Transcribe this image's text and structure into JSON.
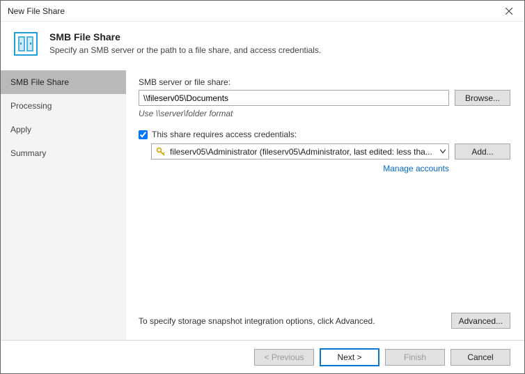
{
  "window": {
    "title": "New File Share"
  },
  "header": {
    "title": "SMB File Share",
    "subtitle": "Specify an SMB server or the path to a file share, and access credentials."
  },
  "sidebar": {
    "items": [
      {
        "label": "SMB File Share",
        "selected": true
      },
      {
        "label": "Processing",
        "selected": false
      },
      {
        "label": "Apply",
        "selected": false
      },
      {
        "label": "Summary",
        "selected": false
      }
    ]
  },
  "content": {
    "server_label": "SMB server or file share:",
    "server_value": "\\\\fileserv05\\Documents",
    "browse_label": "Browse...",
    "format_hint": "Use \\\\server\\folder format",
    "creds_checkbox_label": "This share requires access credentials:",
    "creds_checked": true,
    "creds_selected": "fileserv05\\Administrator (fileserv05\\Administrator, last edited: less tha...",
    "add_label": "Add...",
    "manage_link": "Manage accounts",
    "snapshot_text": "To specify storage snapshot integration options, click Advanced.",
    "advanced_label": "Advanced..."
  },
  "footer": {
    "previous": "< Previous",
    "next": "Next >",
    "finish": "Finish",
    "cancel": "Cancel"
  }
}
